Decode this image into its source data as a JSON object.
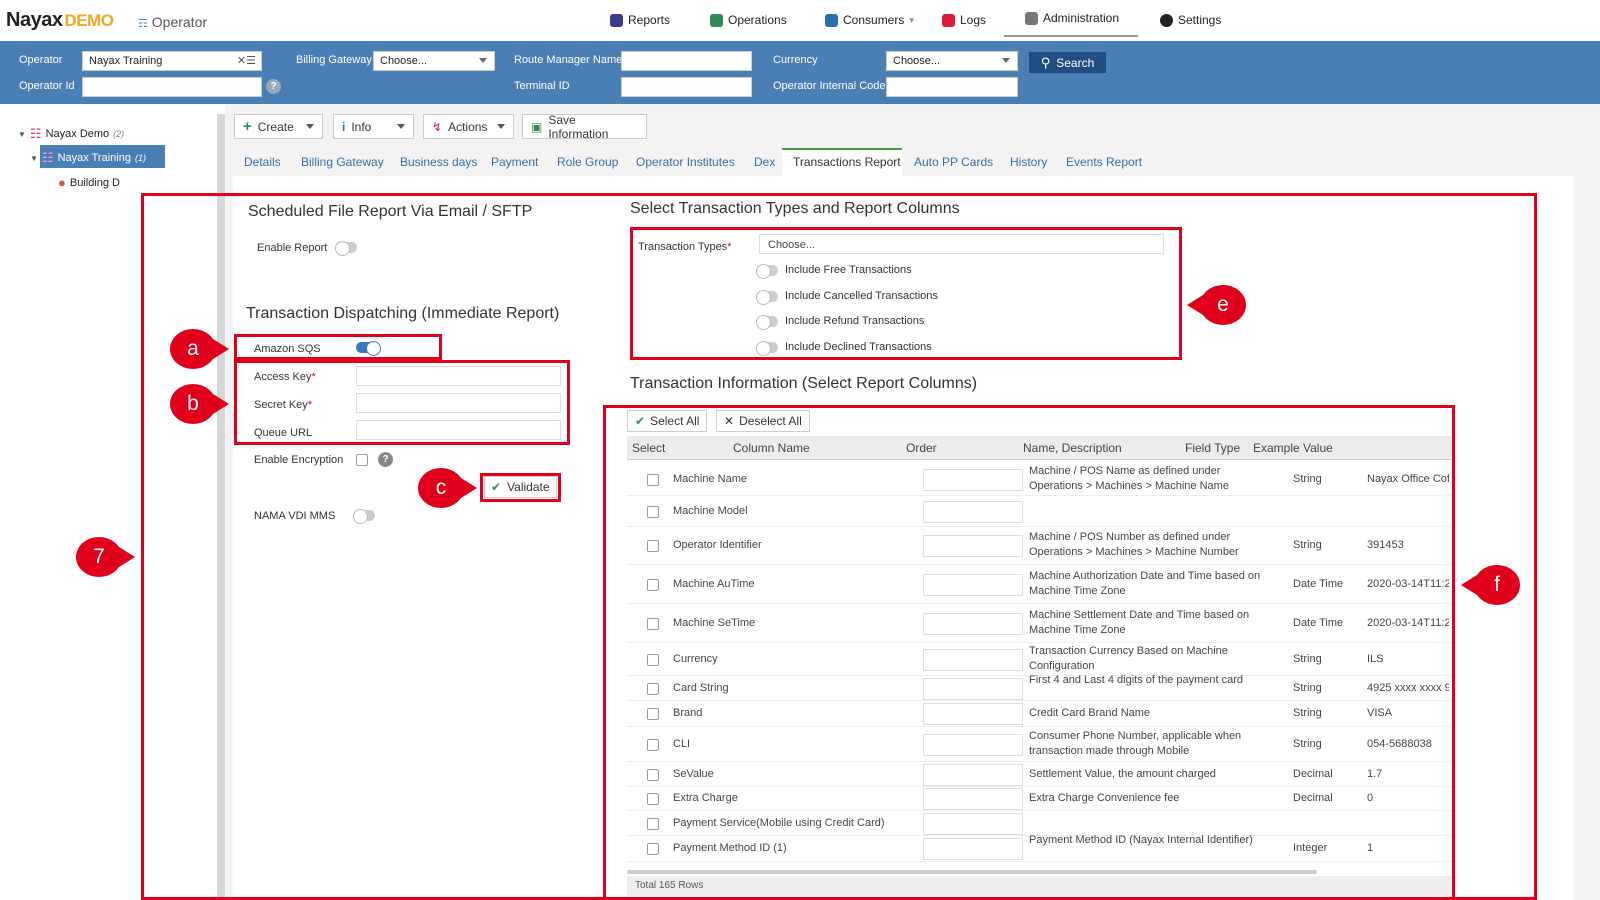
{
  "brand": {
    "logo": "Nayax",
    "logo_suffix": "DEMO",
    "context": "Operator"
  },
  "nav": {
    "reports": "Reports",
    "operations": "Operations",
    "consumers": "Consumers",
    "logs": "Logs",
    "administration": "Administration",
    "settings": "Settings"
  },
  "filters": {
    "operator_label": "Operator",
    "operator_value": "Nayax Training",
    "operator_id_label": "Operator Id",
    "billing_gateway_label": "Billing Gateway",
    "billing_gateway_value": "Choose...",
    "route_manager_label": "Route Manager Name",
    "terminal_id_label": "Terminal ID",
    "currency_label": "Currency",
    "currency_value": "Choose...",
    "internal_code_label": "Operator Internal Code",
    "search_label": "Search"
  },
  "tree": {
    "root": "Nayax Demo",
    "root_count": "(2)",
    "child": "Nayax Training",
    "child_count": "(1)",
    "leaf": "Building D"
  },
  "toolbar": {
    "create": "Create",
    "info": "Info",
    "actions": "Actions",
    "save": "Save Information"
  },
  "tabs": [
    "Details",
    "Billing Gateway",
    "Business days",
    "Payment",
    "Role Group",
    "Operator Institutes",
    "Dex",
    "Transactions Report",
    "Auto PP Cards",
    "History",
    "Events Report"
  ],
  "scheduled": {
    "title": "Scheduled File Report Via Email / SFTP",
    "enable_report": "Enable Report"
  },
  "dispatching": {
    "title": "Transaction Dispatching (Immediate Report)",
    "amazon_sqs": "Amazon SQS",
    "access_key": "Access Key",
    "secret_key": "Secret Key",
    "queue_url": "Queue URL",
    "required_mark": "*",
    "enable_encryption": "Enable Encryption",
    "validate": "Validate",
    "nama": "NAMA VDI MMS"
  },
  "types": {
    "title": "Select Transaction Types and Report Columns",
    "label": "Transaction Types",
    "placeholder": "Choose...",
    "options": [
      "Include Free Transactions",
      "Include Cancelled Transactions",
      "Include Refund Transactions",
      "Include Declined Transactions"
    ]
  },
  "info": {
    "title": "Transaction Information (Select Report Columns)",
    "select_all": "Select All",
    "deselect_all": "Deselect All",
    "headers": [
      "Select",
      "Column Name",
      "Order",
      "Name, Description",
      "Field Type",
      "Example Value"
    ],
    "rows": [
      {
        "name": "Machine Name",
        "desc": "Machine / POS Name as defined under Operations > Machines > Machine Name",
        "type": "String",
        "example": "Nayax Office Cof"
      },
      {
        "name": "Machine Model",
        "desc": "",
        "type": "",
        "example": ""
      },
      {
        "name": "Operator Identifier",
        "desc": "Machine / POS Number as defined under Operations > Machines > Machine Number",
        "type": "String",
        "example": "391453"
      },
      {
        "name": "Machine AuTime",
        "desc": "Machine Authorization Date and Time based on Machine Time Zone",
        "type": "Date Time",
        "example": "2020-03-14T11:2"
      },
      {
        "name": "Machine SeTime",
        "desc": "Machine Settlement Date and Time based on Machine Time Zone",
        "type": "Date Time",
        "example": "2020-03-14T11:2"
      },
      {
        "name": "Currency",
        "desc": "Transaction Currency Based on Machine Configuration",
        "type": "String",
        "example": "ILS"
      },
      {
        "name": "Card String",
        "desc": "First 4 and Last 4 digits of the payment card",
        "type": "String",
        "example": "4925 xxxx xxxx 9!"
      },
      {
        "name": "Brand",
        "desc": "Credit Card Brand Name",
        "type": "String",
        "example": "VISA"
      },
      {
        "name": "CLI",
        "desc": "Consumer Phone Number, applicable when transaction made through Mobile",
        "type": "String",
        "example": "054-5688038"
      },
      {
        "name": "SeValue",
        "desc": "Settlement Value, the amount charged",
        "type": "Decimal",
        "example": "1.7"
      },
      {
        "name": "Extra Charge",
        "desc": "Extra Charge Convenience fee",
        "type": "Decimal",
        "example": "0"
      },
      {
        "name": "Payment Service(Mobile using Credit Card)",
        "desc": "",
        "type": "",
        "example": ""
      },
      {
        "name": "Payment Method ID (1)",
        "desc": "Payment Method ID (Nayax Internal Identifier)",
        "type": "Integer",
        "example": "1"
      }
    ],
    "footer": "Total 165 Rows"
  },
  "callouts": {
    "a": "a",
    "b": "b",
    "c": "c",
    "e": "e",
    "f": "f",
    "seven": "7"
  },
  "colors": {
    "primary": "#4a7fb6",
    "annotation": "#e0001b",
    "active_tab": "#3c9e3c"
  }
}
